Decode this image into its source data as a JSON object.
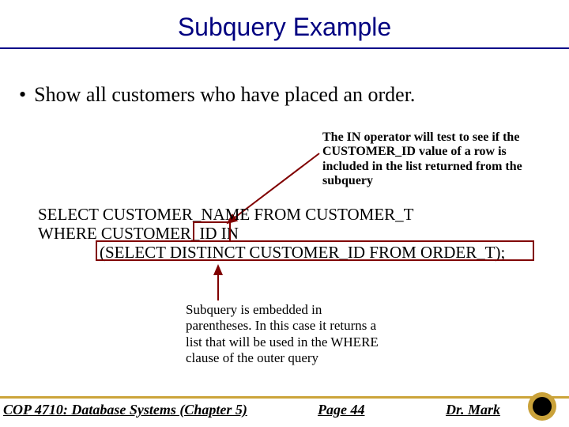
{
  "title": "Subquery Example",
  "bullet": "Show all customers who have placed an order.",
  "annot_top": "The IN operator will test to see if the CUSTOMER_ID value of a row is included in the list returned from the subquery",
  "sql": {
    "line1": "SELECT CUSTOMER_NAME FROM CUSTOMER_T",
    "line2": "WHERE CUSTOMER_ID IN",
    "line3": "(SELECT DISTINCT CUSTOMER_ID FROM ORDER_T);"
  },
  "annot_bottom": "Subquery is embedded in parentheses. In this case it returns a list that will be used in the WHERE clause of the outer query",
  "footer": {
    "left": "COP 4710: Database Systems  (Chapter 5)",
    "mid": "Page 44",
    "right": "Dr. Mark"
  }
}
